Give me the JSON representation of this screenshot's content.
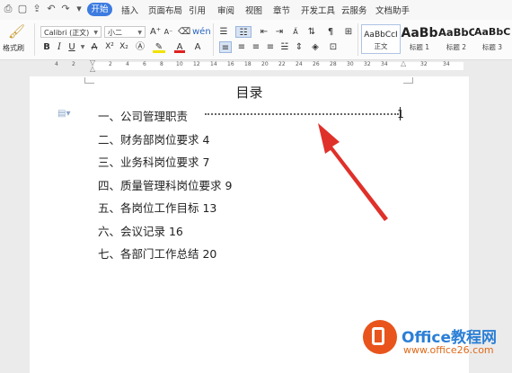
{
  "menubar": {
    "tabs": [
      "开始",
      "插入",
      "页面布局",
      "引用",
      "审阅",
      "视图",
      "章节",
      "开发工具",
      "云服务",
      "文档助手"
    ],
    "active_tab": "开始"
  },
  "ribbon": {
    "format_painter_label": "格式刷",
    "font_name": "Calibri (正文)",
    "font_size": "小二",
    "styles": [
      {
        "sample": "AaBbCcI",
        "caption": "正文"
      },
      {
        "sample": "AaBb",
        "caption": "标题 1"
      },
      {
        "sample": "AaBbC",
        "caption": "标题 2"
      },
      {
        "sample": "AaBbC",
        "caption": "标题 3"
      }
    ]
  },
  "ruler": {
    "numbers": [
      "4",
      "2",
      "2",
      "4",
      "6",
      "8",
      "10",
      "12",
      "14",
      "16",
      "18",
      "20",
      "22",
      "24",
      "26",
      "28",
      "30",
      "32",
      "34"
    ]
  },
  "document": {
    "title": "目录",
    "entries": [
      {
        "text": "一、公司管理职责",
        "page": "1"
      },
      {
        "text": "二、财务部岗位要求 4"
      },
      {
        "text": "三、业务科岗位要求 7"
      },
      {
        "text": "四、质量管理科岗位要求 9"
      },
      {
        "text": "五、各岗位工作目标 13"
      },
      {
        "text": "六、会议记录 16"
      },
      {
        "text": "七、各部门工作总结 20"
      }
    ]
  },
  "watermark": {
    "brand": "Office教程网",
    "url": "www.office26.com"
  },
  "colors": {
    "accent": "#3c7be0",
    "arrow": "#e0302a",
    "logo": "#e8541c"
  }
}
